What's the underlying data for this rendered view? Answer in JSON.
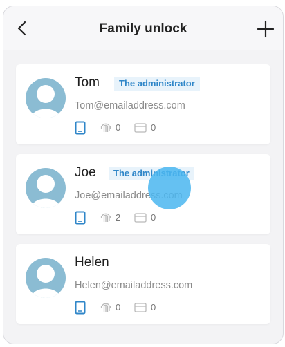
{
  "header": {
    "title": "Family unlock"
  },
  "members": [
    {
      "name": "Tom",
      "badge": "The administrator",
      "email": "Tom@emailaddress.com",
      "fingerprint_count": "0",
      "card_count": "0"
    },
    {
      "name": "Joe",
      "badge": "The administrator",
      "email": "Joe@emailaddress.com",
      "fingerprint_count": "2",
      "card_count": "0"
    },
    {
      "name": "Helen",
      "badge": "",
      "email": "Helen@emailaddress.com",
      "fingerprint_count": "0",
      "card_count": "0"
    }
  ],
  "colors": {
    "accent": "#2f86c8",
    "badge_bg": "#e8f3fb",
    "avatar": "#8bbcd3",
    "touch_indicator": "#4ab6f0"
  },
  "icons": [
    "back-arrow-icon",
    "plus-icon",
    "phone-icon",
    "fingerprint-icon",
    "card-icon",
    "avatar-icon"
  ]
}
